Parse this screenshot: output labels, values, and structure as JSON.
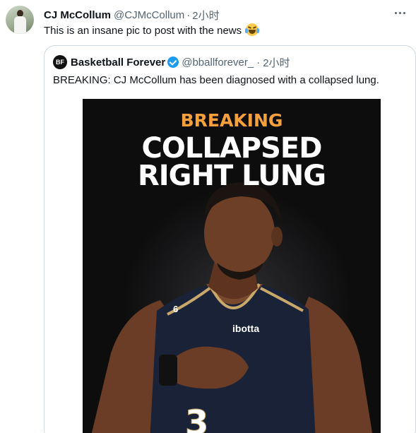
{
  "tweet": {
    "author_name": "CJ McCollum",
    "author_handle": "@CJMcCollum",
    "separator": "·",
    "time": "2小时",
    "text": "This is an insane pic to post with the news",
    "emoji": "joy-emoji"
  },
  "quoted_tweet": {
    "avatar_text": "BF",
    "author_name": "Basketball Forever",
    "verified": true,
    "author_handle": "@bballforever_",
    "separator": "·",
    "time": "2小时",
    "text": "BREAKING: CJ McCollum has been diagnosed with a collapsed lung."
  },
  "media": {
    "kicker": "BREAKING",
    "headline_line1": "COLLAPSED",
    "headline_line2": "RIGHT LUNG",
    "jersey_sponsor": "ibotta",
    "jersey_number": "3",
    "shoulder_number": "6"
  },
  "colors": {
    "accent": "#f5a03a",
    "verified": "#1d9bf0",
    "muted_text": "#536471",
    "border": "#cfd9de"
  }
}
